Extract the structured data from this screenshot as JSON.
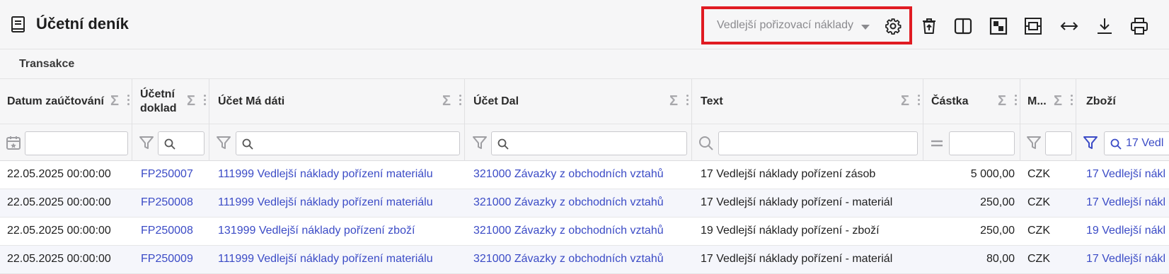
{
  "page": {
    "title": "Účetní deník"
  },
  "toolbar": {
    "view_select": {
      "value": "Vedlejší pořizovací náklady"
    },
    "icons": [
      "settings-icon",
      "delete-layout-icon",
      "split-view-icon",
      "pivot-icon",
      "fit-screen-icon",
      "expand-width-icon",
      "download-icon",
      "print-icon"
    ]
  },
  "tabs": {
    "active": "Transakce"
  },
  "columns": [
    {
      "key": "date",
      "label": "Datum zaúčtování"
    },
    {
      "key": "doc",
      "label1": "Účetní",
      "label2": "doklad"
    },
    {
      "key": "debit",
      "label": "Účet Má dáti"
    },
    {
      "key": "credit",
      "label": "Účet Dal"
    },
    {
      "key": "text",
      "label": "Text"
    },
    {
      "key": "amount",
      "label": "Částka"
    },
    {
      "key": "currency",
      "label": "M..."
    },
    {
      "key": "goods",
      "label": "Zboží"
    }
  ],
  "filters": {
    "goods_value": "17 Vedl"
  },
  "rows": [
    {
      "date": "22.05.2025 00:00:00",
      "doc": "FP250007",
      "debit": "111999 Vedlejší náklady pořízení materiálu",
      "credit": "321000 Závazky z obchodních vztahů",
      "text": "17 Vedlejší náklady pořízení zásob",
      "amount": "5 000,00",
      "currency": "CZK",
      "goods": "17 Vedlejší nákl"
    },
    {
      "date": "22.05.2025 00:00:00",
      "doc": "FP250008",
      "debit": "111999 Vedlejší náklady pořízení materiálu",
      "credit": "321000 Závazky z obchodních vztahů",
      "text": "17 Vedlejší náklady pořízení - materiál",
      "amount": "250,00",
      "currency": "CZK",
      "goods": "17 Vedlejší nákl"
    },
    {
      "date": "22.05.2025 00:00:00",
      "doc": "FP250008",
      "debit": "131999 Vedlejší náklady pořízení zboží",
      "credit": "321000 Závazky z obchodních vztahů",
      "text": "19 Vedlejší náklady pořízení - zboží",
      "amount": "250,00",
      "currency": "CZK",
      "goods": "19 Vedlejší nákl"
    },
    {
      "date": "22.05.2025 00:00:00",
      "doc": "FP250009",
      "debit": "111999 Vedlejší náklady pořízení materiálu",
      "credit": "321000 Závazky z obchodních vztahů",
      "text": "17 Vedlejší náklady pořízení - materiál",
      "amount": "80,00",
      "currency": "CZK",
      "goods": "17 Vedlejší nákl"
    }
  ],
  "colors": {
    "link": "#3b4bc6",
    "highlight_border": "#e01b22"
  }
}
